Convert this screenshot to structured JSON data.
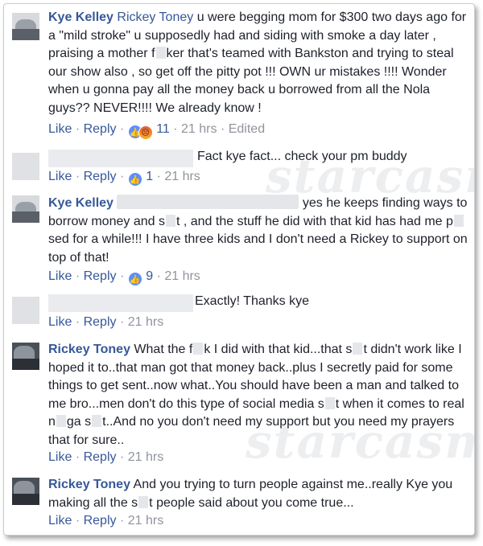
{
  "comments": [
    {
      "author": "Kye Kelley",
      "mention": "Rickey Toney",
      "text": " u were begging mom for $300 two days ago for a \"mild stroke\" u supposedly had and siding with smoke a day later , praising a mother f",
      "text_b": "ker that's teamed with Bankston and trying to steal our show also , so get off the pitty pot !!! OWN ur mistakes !!!! Wonder when u gonna pay all the money back u borrowed from all the Nola guys?? NEVER!!!! We already know !",
      "like": "Like",
      "reply": "Reply",
      "reaction_count": "11",
      "time": "21 hrs",
      "edited": "Edited"
    },
    {
      "text": "Fact kye fact... check your pm buddy",
      "like": "Like",
      "reply": "Reply",
      "reaction_count": "1",
      "time": "21 hrs"
    },
    {
      "author": "Kye Kelley",
      "text_a": "yes he keeps finding ways to borrow money and s",
      "text_b": "t , and the stuff he did with that kid has had me p",
      "text_c": "sed for a while!!! I have three kids and I don't need a Rickey to support on top of that!",
      "like": "Like",
      "reply": "Reply",
      "reaction_count": "9",
      "time": "21 hrs"
    },
    {
      "text": "Exactly! Thanks kye",
      "like": "Like",
      "reply": "Reply",
      "time": "21 hrs"
    },
    {
      "author": "Rickey Toney",
      "text_a": " What the f",
      "text_b": "k I did with that kid...that s",
      "text_c": "t didn't work like I hoped it to..that man got that money back..plus I secretly paid for some things to get sent..now what..You should have been a man and talked to me bro...men don't do this type of social media s",
      "text_d": "t when it comes to real n",
      "text_e": "ga s",
      "text_f": "t..And no you don't need my support but you need my prayers that for sure..",
      "like": "Like",
      "reply": "Reply",
      "time": "21 hrs"
    },
    {
      "author": "Rickey Toney",
      "text_a": " And you trying to turn people against me..really Kye you making all the s",
      "text_b": "t people said about you come true...",
      "like": "Like",
      "reply": "Reply",
      "time": "21 hrs"
    }
  ],
  "watermark": "starcasm",
  "colors": {
    "link": "#365899",
    "text": "#1d2129",
    "meta": "#90949c",
    "like_reaction": "#5890ff"
  }
}
